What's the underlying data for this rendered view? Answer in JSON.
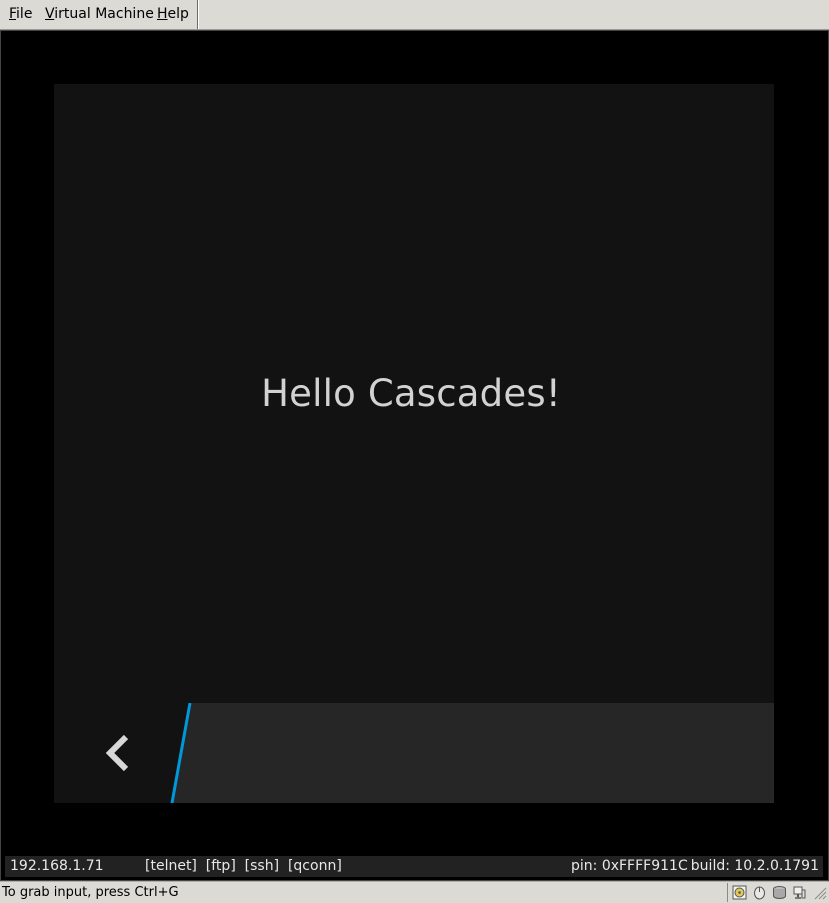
{
  "menubar": {
    "items": [
      {
        "mnemonic": "F",
        "rest": "ile"
      },
      {
        "mnemonic": "V",
        "rest": "irtual Machine"
      },
      {
        "mnemonic": "H",
        "rest": "elp"
      }
    ]
  },
  "screen": {
    "hello_text": "Hello Cascades!"
  },
  "actionbar": {
    "back_icon": "chevron-left-icon",
    "accent_color": "#0098da"
  },
  "statusbar": {
    "ip": "192.168.1.71",
    "links": "[telnet]  [ftp]  [ssh]  [qconn]",
    "pin": "pin: 0xFFFF911C",
    "build": "build: 10.2.0.1791"
  },
  "hintbar": {
    "text": "To grab input, press Ctrl+G",
    "tray_icons": [
      "cd-icon",
      "mouse-icon",
      "disk-icon",
      "network-icon"
    ]
  }
}
